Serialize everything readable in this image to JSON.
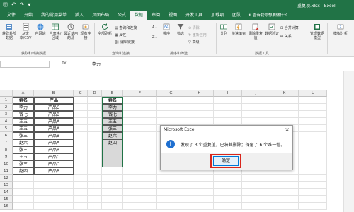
{
  "titlebar": {
    "title": "重复项.xlsx - Excel"
  },
  "tabs": [
    "文件",
    "开始",
    "我的常用菜单",
    "插入",
    "页面布局",
    "公式",
    "数据",
    "审阅",
    "视图",
    "开发工具",
    "加载项",
    "团队"
  ],
  "active_tab": "数据",
  "tell_me": "告诉我你想要做什么",
  "ribbon": {
    "get_external": "获取外部数据",
    "from_csv": "从文本/CSV",
    "from_web": "自网站",
    "from_table": "自表格/区域",
    "recent": "最近使用的源",
    "existing": "现有连接",
    "get_transform": "获取和转换数据",
    "refresh_all": "全部刷新",
    "queries": "查询和连接",
    "properties": "属性",
    "edit_links": "编辑链接",
    "queries_group": "查询和连接",
    "sort_asc": "A↓",
    "sort_desc": "Z↓",
    "sort": "排序",
    "filter": "筛选",
    "clear": "清除",
    "reapply": "重新应用",
    "advanced": "高级",
    "sort_filter_group": "排序和筛选",
    "text_to_cols": "分列",
    "flash_fill": "快速填充",
    "remove_dup": "删除重复值",
    "validate": "数据验证",
    "consolidate": "合并计算",
    "relations": "关系",
    "manage_model": "管理数据模型",
    "data_tools_group": "数据工具",
    "what_if": "模拟分析"
  },
  "formula_bar": {
    "name_box": "",
    "fx": "fx",
    "value": "李力"
  },
  "columns": [
    "A",
    "B",
    "C",
    "D",
    "E",
    "F",
    "G",
    "H",
    "I",
    "J",
    "K",
    "L"
  ],
  "rows": [
    "1",
    "2",
    "3",
    "4",
    "5",
    "6",
    "7",
    "8",
    "9",
    "10",
    "11",
    "12",
    "13",
    "14",
    "15",
    "16",
    "17"
  ],
  "table_ab": [
    [
      "姓名",
      "产品"
    ],
    [
      "李力",
      "产品C"
    ],
    [
      "钱七",
      "产品B"
    ],
    [
      "王五",
      "产品A"
    ],
    [
      "王五",
      "产品A"
    ],
    [
      "张三",
      "产品B"
    ],
    [
      "赵六",
      "产品A"
    ],
    [
      "张三",
      "产品B"
    ],
    [
      "王五",
      "产品C"
    ],
    [
      "张三",
      "产品C"
    ],
    [
      "赵四",
      "产品B"
    ]
  ],
  "column_e": [
    "姓名",
    "李力",
    "钱七",
    "王五",
    "张三",
    "赵六",
    "赵四"
  ],
  "dialog": {
    "title": "Microsoft Excel",
    "close": "×",
    "icon": "i",
    "message": "发现了 3 个重复值，已将其删除；保留了 6 个唯一值。",
    "ok": "确定"
  },
  "colors": {
    "brand": "#217346",
    "highlight": "#d9261c",
    "info": "#1e6fd0"
  }
}
